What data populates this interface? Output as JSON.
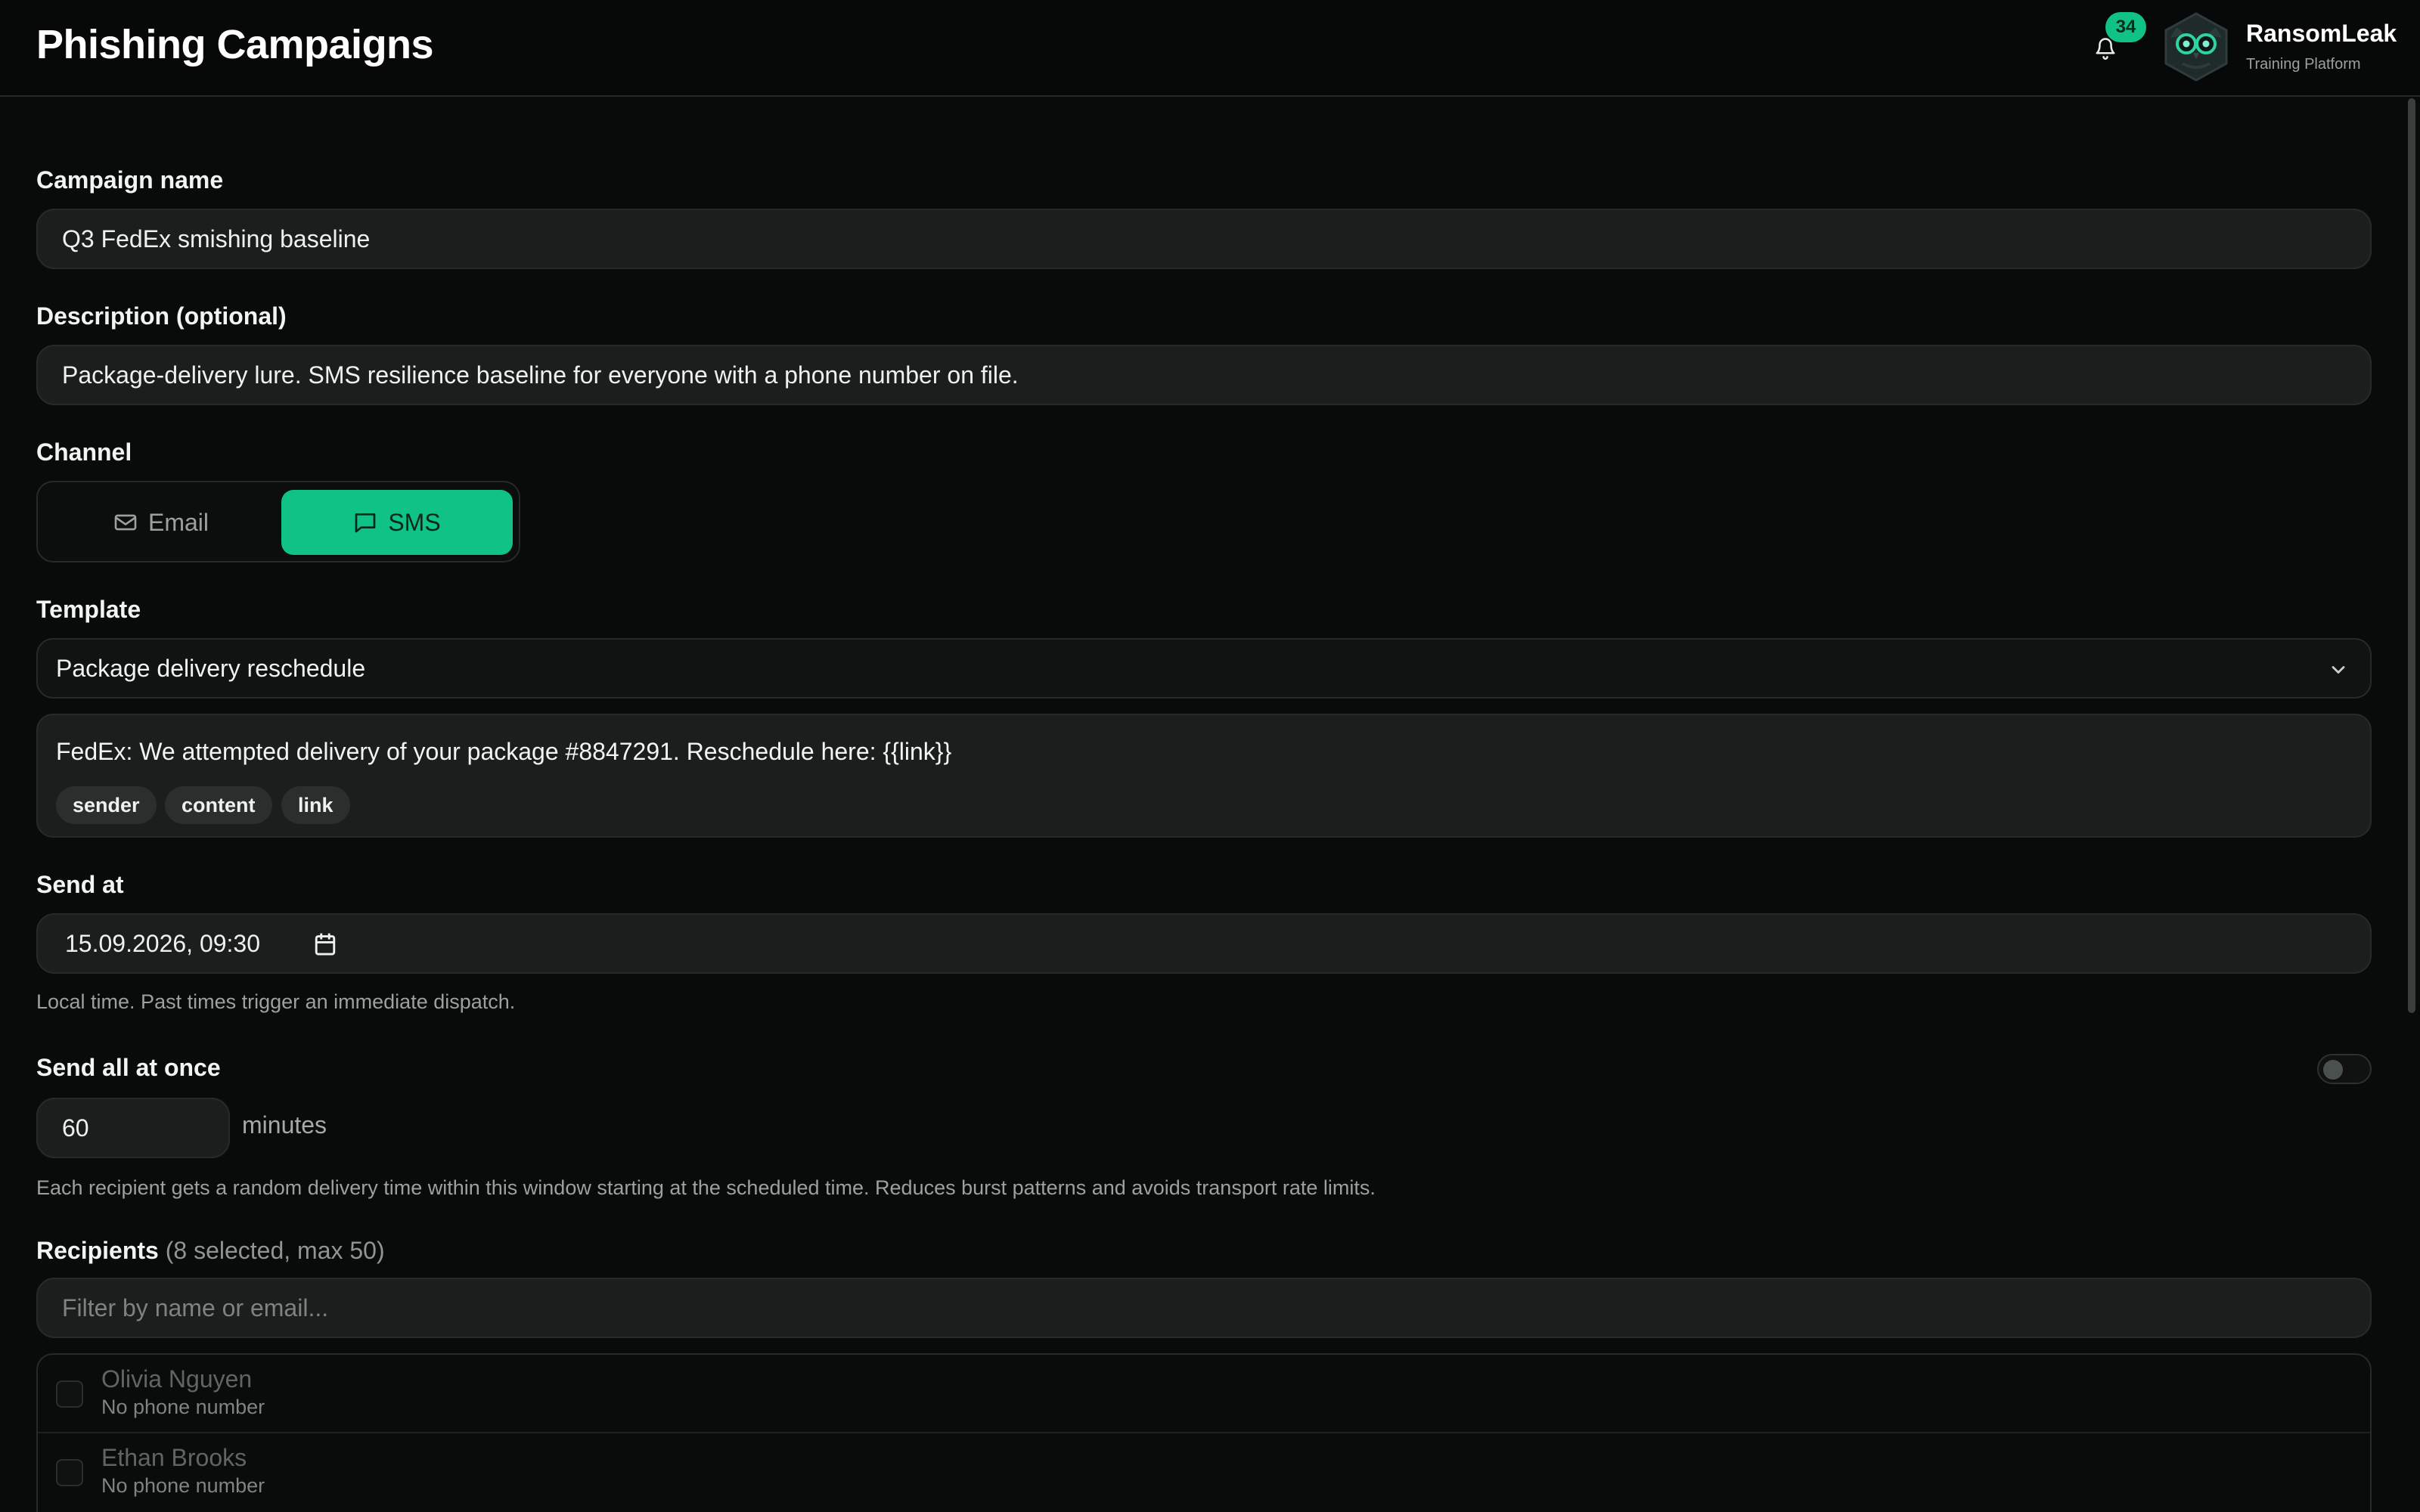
{
  "header": {
    "title": "Phishing Campaigns",
    "notification_count": "34",
    "brand_name": "RansomLeak",
    "brand_subtitle": "Training Platform"
  },
  "form": {
    "campaign_name": {
      "label": "Campaign name",
      "value": "Q3 FedEx smishing baseline"
    },
    "description": {
      "label": "Description (optional)",
      "value": "Package-delivery lure. SMS resilience baseline for everyone with a phone number on file."
    },
    "channel": {
      "label": "Channel",
      "options": [
        "Email",
        "SMS"
      ],
      "selected": "SMS"
    },
    "template": {
      "label": "Template",
      "selected": "Package delivery reschedule",
      "preview_text": "FedEx: We attempted delivery of your package #8847291. Reschedule here: {{link}}",
      "tags": [
        "sender",
        "content",
        "link"
      ]
    },
    "send_at": {
      "label": "Send at",
      "value": "15.09.2026, 09:30",
      "hint": "Local time. Past times trigger an immediate dispatch."
    },
    "send_all_at_once": {
      "label": "Send all at once",
      "enabled": false,
      "window_value": "60",
      "unit": "minutes",
      "hint": "Each recipient gets a random delivery time within this window starting at the scheduled time. Reduces burst patterns and avoids transport rate limits."
    },
    "recipients": {
      "label": "Recipients",
      "count_text": "(8 selected, max 50)",
      "filter_placeholder": "Filter by name or email...",
      "items": [
        {
          "name": "Olivia Nguyen",
          "detail": "No phone number"
        },
        {
          "name": "Ethan Brooks",
          "detail": "No phone number"
        }
      ]
    }
  },
  "colors": {
    "accent": "#10c286",
    "background": "#090b0a",
    "field": "#1b1e1d"
  }
}
